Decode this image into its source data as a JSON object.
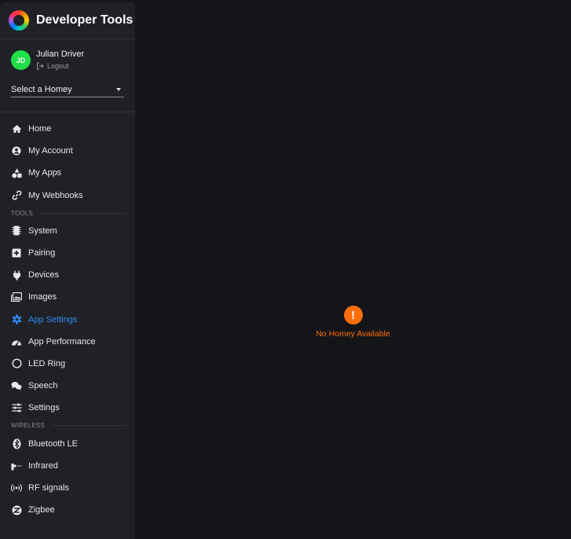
{
  "brand": {
    "title": "Developer Tools"
  },
  "user": {
    "initials": "JD",
    "name": "Julian Driver",
    "logout_label": "Logout"
  },
  "homey_select": {
    "value": "Select a Homey"
  },
  "nav_main": [
    {
      "label": "Home",
      "icon": "home-icon"
    },
    {
      "label": "My Account",
      "icon": "account-icon"
    },
    {
      "label": "My Apps",
      "icon": "apps-icon"
    },
    {
      "label": "My Webhooks",
      "icon": "webhooks-icon"
    }
  ],
  "sections": {
    "tools": "TOOLS",
    "wireless": "WIRELESS"
  },
  "nav_tools": [
    {
      "label": "System",
      "icon": "chip-icon"
    },
    {
      "label": "Pairing",
      "icon": "plus-box-icon"
    },
    {
      "label": "Devices",
      "icon": "plug-icon"
    },
    {
      "label": "Images",
      "icon": "image-icon"
    },
    {
      "label": "App Settings",
      "icon": "gear-icon",
      "active": true
    },
    {
      "label": "App Performance",
      "icon": "gauge-icon"
    },
    {
      "label": "LED Ring",
      "icon": "ring-icon"
    },
    {
      "label": "Speech",
      "icon": "speech-icon"
    },
    {
      "label": "Settings",
      "icon": "sliders-icon"
    }
  ],
  "nav_wireless": [
    {
      "label": "Bluetooth LE",
      "icon": "bluetooth-icon"
    },
    {
      "label": "Infrared",
      "icon": "infrared-icon"
    },
    {
      "label": "RF signals",
      "icon": "rf-icon"
    },
    {
      "label": "Zigbee",
      "icon": "zigbee-icon"
    }
  ],
  "main": {
    "message": "No Homey Available",
    "icon": "alert-icon"
  },
  "colors": {
    "accent": "#2e8bf0",
    "warning": "#ff6d0c",
    "avatar": "#1fe048",
    "background": "#141519",
    "sidebar": "#202126"
  }
}
